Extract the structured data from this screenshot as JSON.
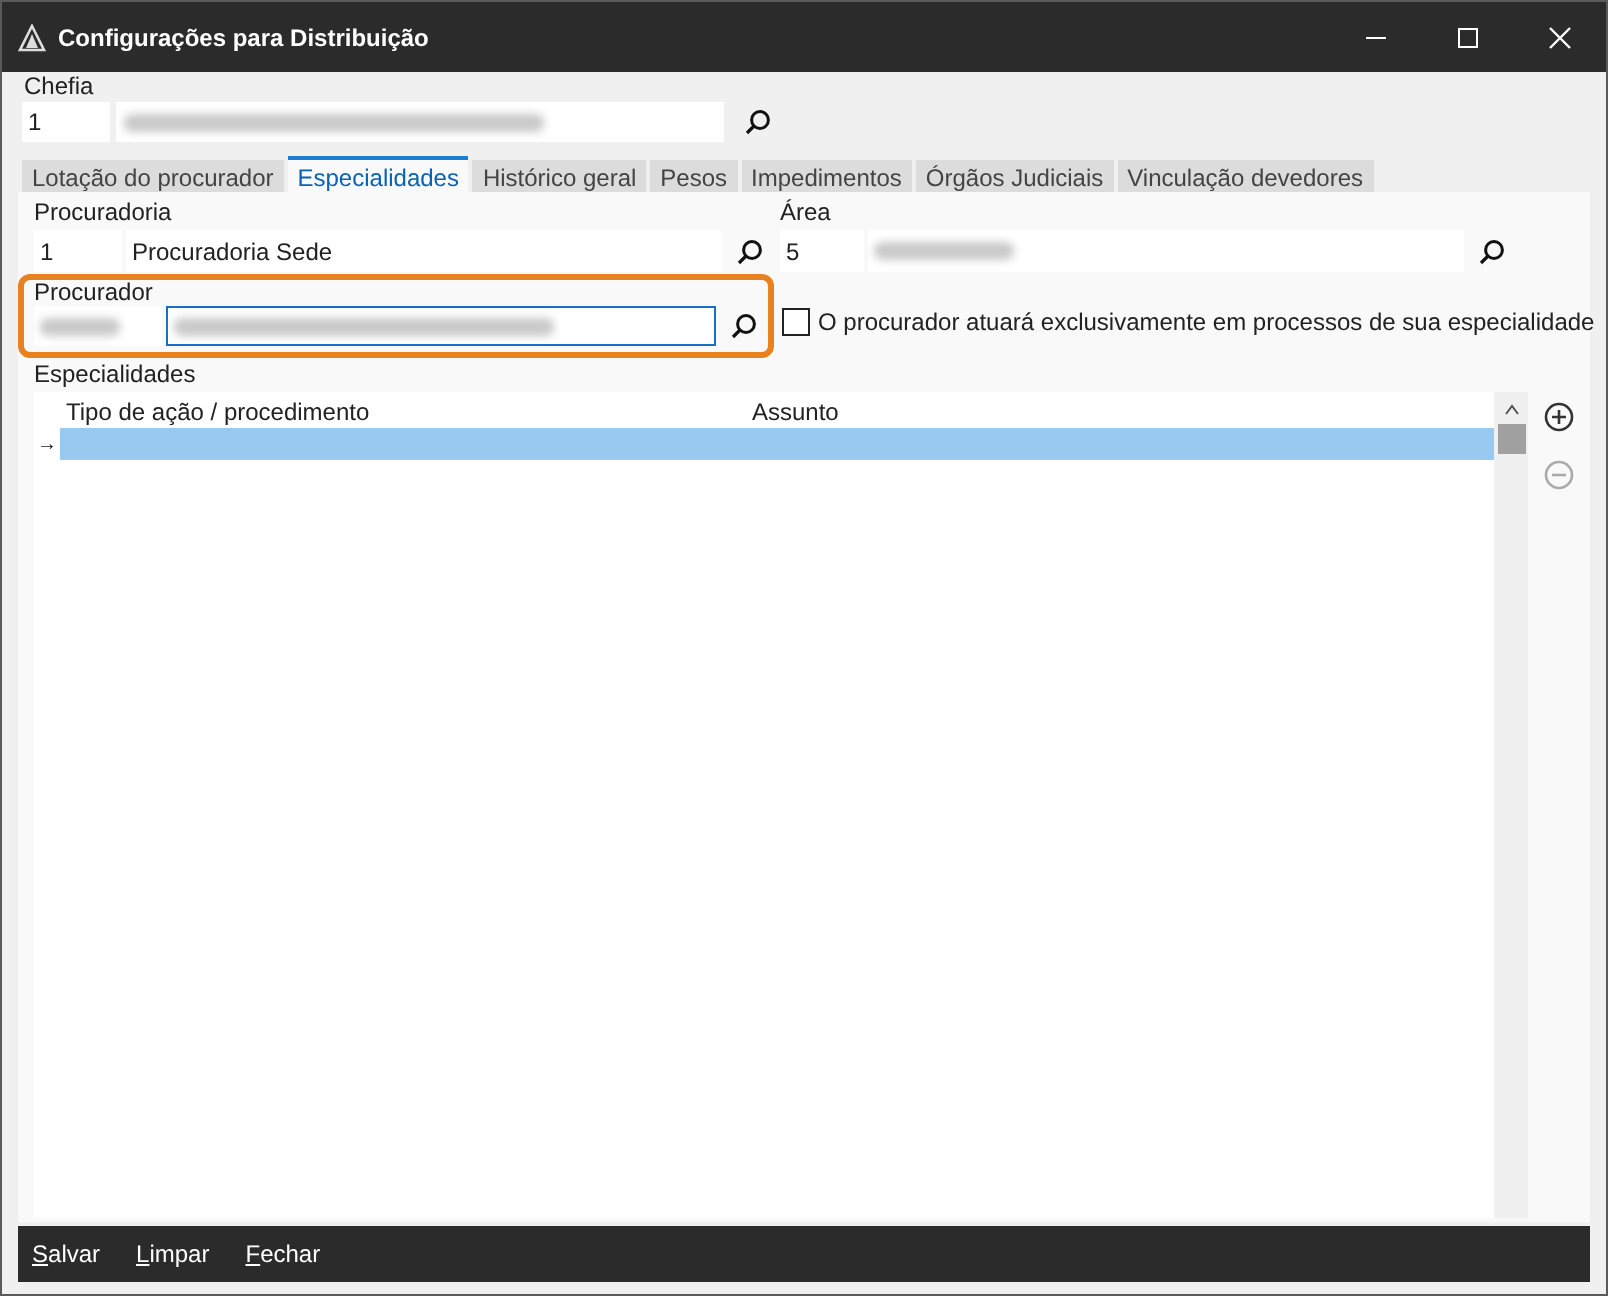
{
  "window": {
    "title": "Configurações para Distribuição"
  },
  "chefia": {
    "label": "Chefia",
    "code": "1",
    "name_redacted": true
  },
  "tabs": [
    {
      "label": "Lotação do procurador",
      "selected": false
    },
    {
      "label": "Especialidades",
      "selected": true
    },
    {
      "label": "Histórico geral",
      "selected": false
    },
    {
      "label": "Pesos",
      "selected": false
    },
    {
      "label": "Impedimentos",
      "selected": false
    },
    {
      "label": "Órgãos Judiciais",
      "selected": false
    },
    {
      "label": "Vinculação devedores",
      "selected": false
    }
  ],
  "procuradoria": {
    "label": "Procuradoria",
    "code": "1",
    "name": "Procuradoria Sede"
  },
  "area": {
    "label": "Área",
    "code": "5",
    "name_redacted": true
  },
  "procurador": {
    "label": "Procurador",
    "code_redacted": true,
    "name_redacted": true,
    "highlighted": true
  },
  "exclusive_checkbox": {
    "label": "O procurador atuará exclusivamente em processos de sua especialidade",
    "checked": false
  },
  "grid": {
    "title": "Especialidades",
    "columns": [
      "Tipo de ação / procedimento",
      "Assunto"
    ],
    "row_marker": "→",
    "rows": [
      {
        "selected": true
      }
    ],
    "add_disabled": false,
    "remove_disabled": true
  },
  "buttons": [
    "Salvar",
    "Limpar",
    "Fechar"
  ]
}
